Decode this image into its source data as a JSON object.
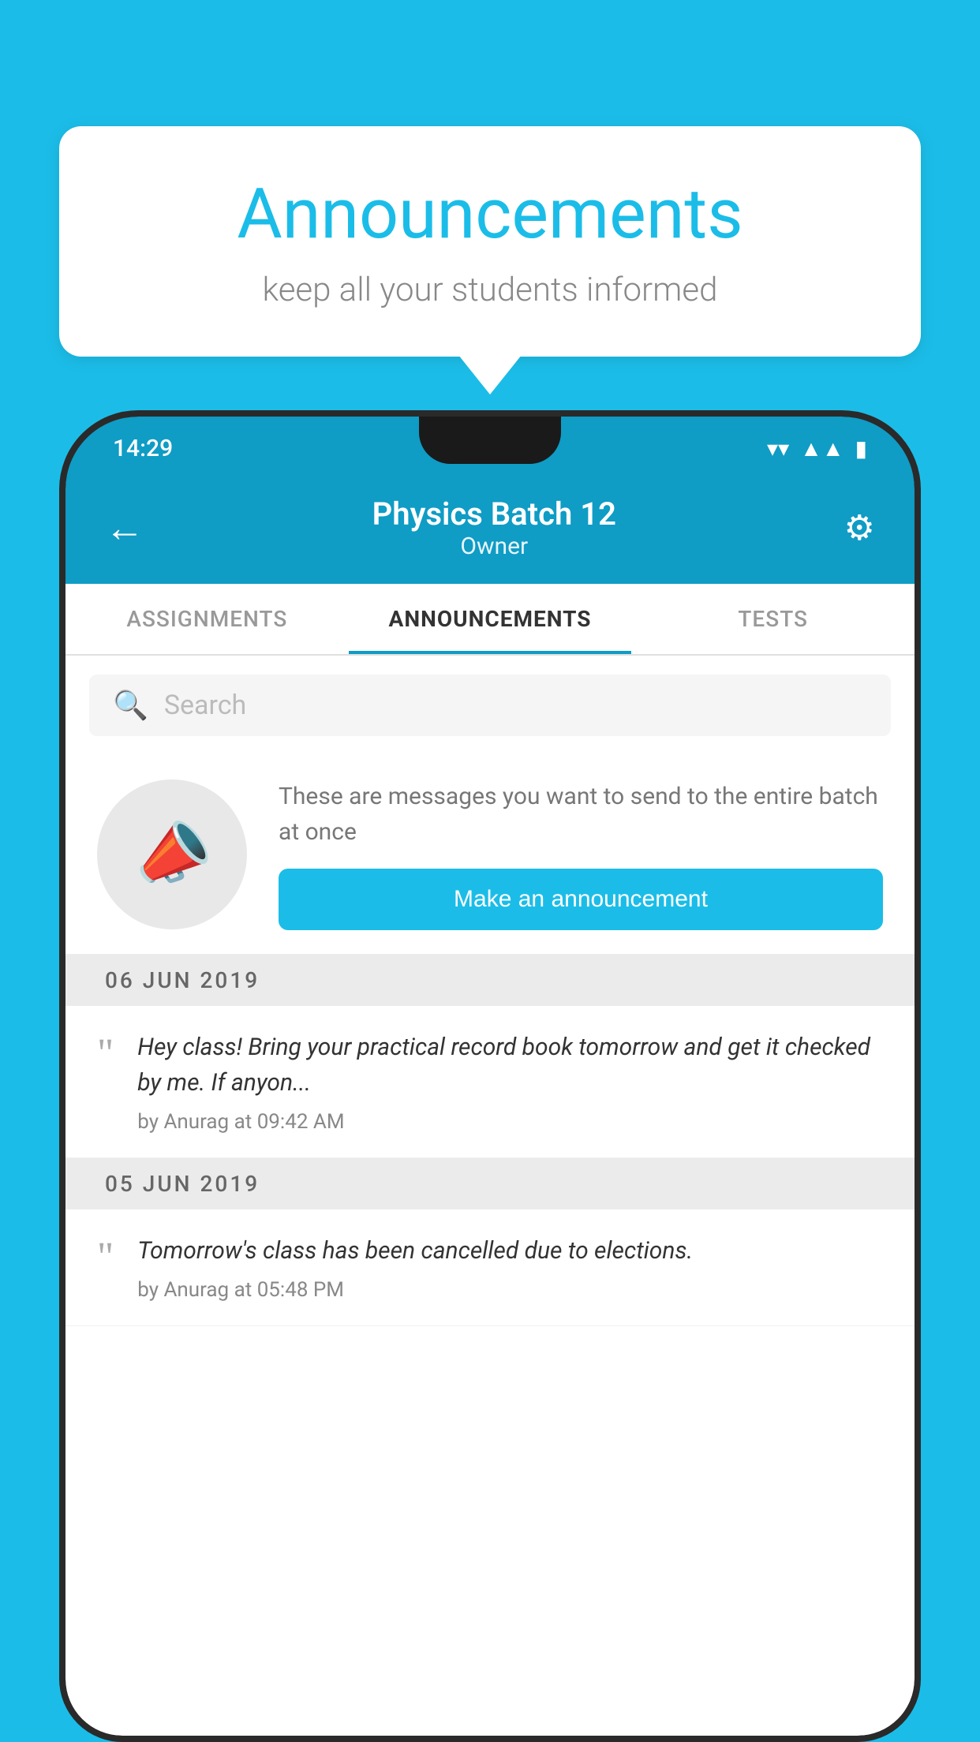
{
  "bubble": {
    "title": "Announcements",
    "subtitle": "keep all your students informed"
  },
  "phone": {
    "status_bar": {
      "time": "14:29",
      "wifi": "▼",
      "signal": "▲",
      "battery": "▮"
    },
    "header": {
      "back_icon": "←",
      "title": "Physics Batch 12",
      "subtitle": "Owner",
      "settings_icon": "⚙"
    },
    "tabs": [
      {
        "label": "ASSIGNMENTS",
        "active": false
      },
      {
        "label": "ANNOUNCEMENTS",
        "active": true
      },
      {
        "label": "TESTS",
        "active": false
      },
      {
        "label": "",
        "active": false
      }
    ],
    "search": {
      "placeholder": "Search"
    },
    "announcement_prompt": {
      "description": "These are messages you want to send to the entire batch at once",
      "button_label": "Make an announcement"
    },
    "entries": [
      {
        "date": "06  JUN  2019",
        "text": "Hey class! Bring your practical record book tomorrow and get it checked by me. If anyon...",
        "meta": "by Anurag at 09:42 AM"
      },
      {
        "date": "05  JUN  2019",
        "text": "Tomorrow's class has been cancelled due to elections.",
        "meta": "by Anurag at 05:48 PM"
      }
    ]
  }
}
